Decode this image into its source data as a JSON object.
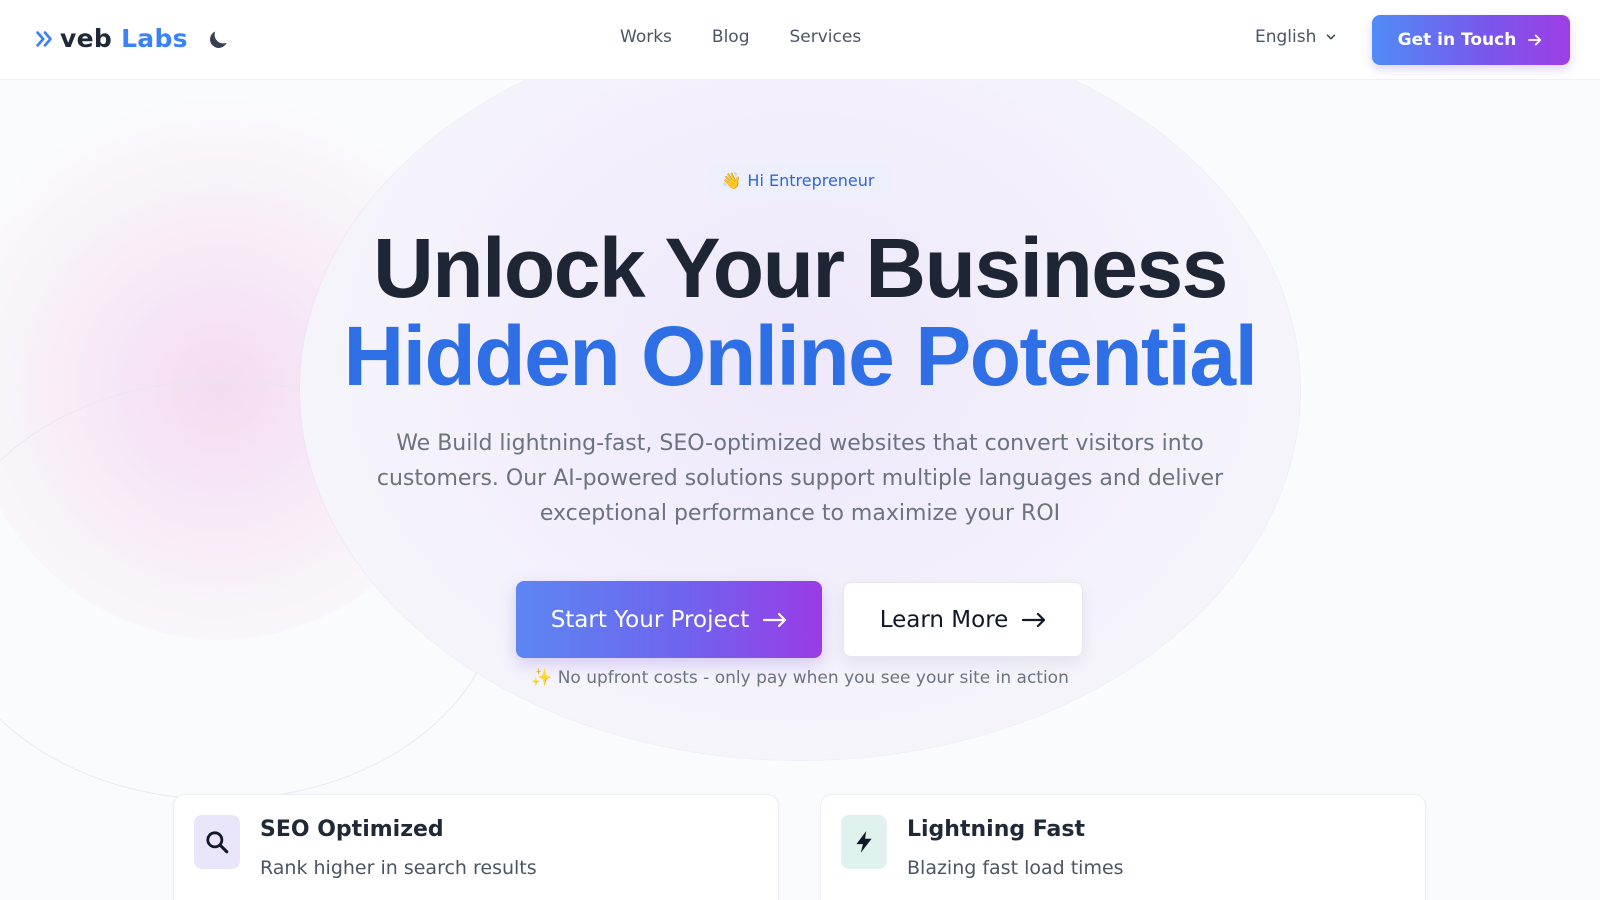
{
  "header": {
    "logo": {
      "part1": "veb",
      "part2": "Labs",
      "icon": "double-chevron-right-icon"
    },
    "theme_toggle_icon": "moon-icon",
    "nav": [
      {
        "label": "Works"
      },
      {
        "label": "Blog"
      },
      {
        "label": "Services"
      }
    ],
    "language": {
      "selected": "English",
      "icon": "chevron-down-icon"
    },
    "cta": {
      "label": "Get in Touch",
      "icon": "arrow-right-icon"
    }
  },
  "hero": {
    "badge": {
      "emoji": "👋",
      "label": "Hi Entrepreneur"
    },
    "title_line1": "Unlock Your Business",
    "title_line2": "Hidden Online Potential",
    "subtitle": "We Build lightning-fast, SEO-optimized websites that convert visitors into customers. Our AI-powered solutions support multiple languages and deliver exceptional performance to maximize your ROI",
    "primary_button": {
      "label": "Start Your Project",
      "icon": "arrow-right-icon"
    },
    "secondary_button": {
      "label": "Learn More",
      "icon": "arrow-right-icon"
    },
    "note": {
      "emoji": "✨",
      "label": "No upfront costs - only pay when you see your site in action"
    }
  },
  "features": [
    {
      "title": "SEO Optimized",
      "text": "Rank higher in search results",
      "icon": "search-icon"
    },
    {
      "title": "Lightning Fast",
      "text": "Blazing fast load times",
      "icon": "lightning-icon"
    }
  ],
  "colors": {
    "brand_blue": "#3b82f6",
    "title_dark": "#1e2535",
    "title_blue": "#2e6fe6",
    "gradient_start": "#4f8cf6",
    "gradient_end": "#9e3ee4"
  }
}
